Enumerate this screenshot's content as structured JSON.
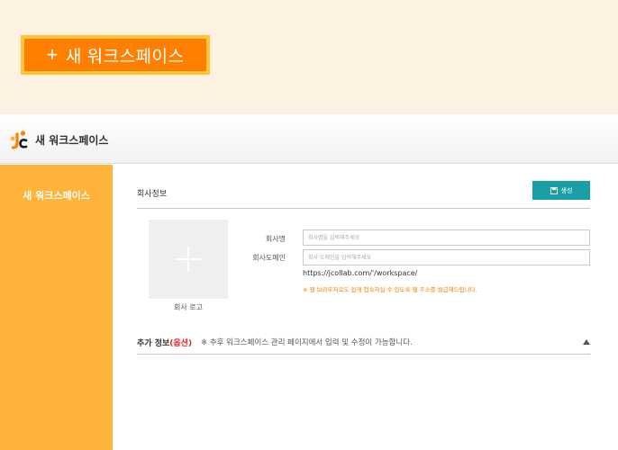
{
  "banner": {
    "new_workspace_label": "새 워크스페이스",
    "plus": "+"
  },
  "header": {
    "title": "새 워크스페이스",
    "logo_icon": "jcollab-logo-icon"
  },
  "sidebar": {
    "items": [
      {
        "label": "새 워크스페이스",
        "active": true
      }
    ]
  },
  "main": {
    "section_title": "회사정보",
    "create_button_label": "생성",
    "logo_caption": "회사 로고",
    "company_name": {
      "label": "회사명",
      "value": "",
      "placeholder": "회사명을 입력해주세요"
    },
    "company_domain": {
      "label": "회사도메인",
      "value": "",
      "placeholder": "회사 도메인을 입력해주세요"
    },
    "url_hint": "https://jcollab.com/'/workspace/",
    "warning": "※ 웹 브라우저로도 쉽게 접속하실 수 있도록 웹 주소를 발급해드립니다.",
    "extra": {
      "title_prefix": "추가 정보",
      "title_optional": "(옵션)",
      "note": "※ 추후 워크스페이스 관리 페이지에서 입력 및 수정이 가능합니다."
    }
  },
  "colors": {
    "orange": "#ff7f00",
    "banner_border": "#ffc53a",
    "sidebar": "#ffb33a",
    "teal_button": "#1a9fa6",
    "optional_red": "#e8232a"
  }
}
